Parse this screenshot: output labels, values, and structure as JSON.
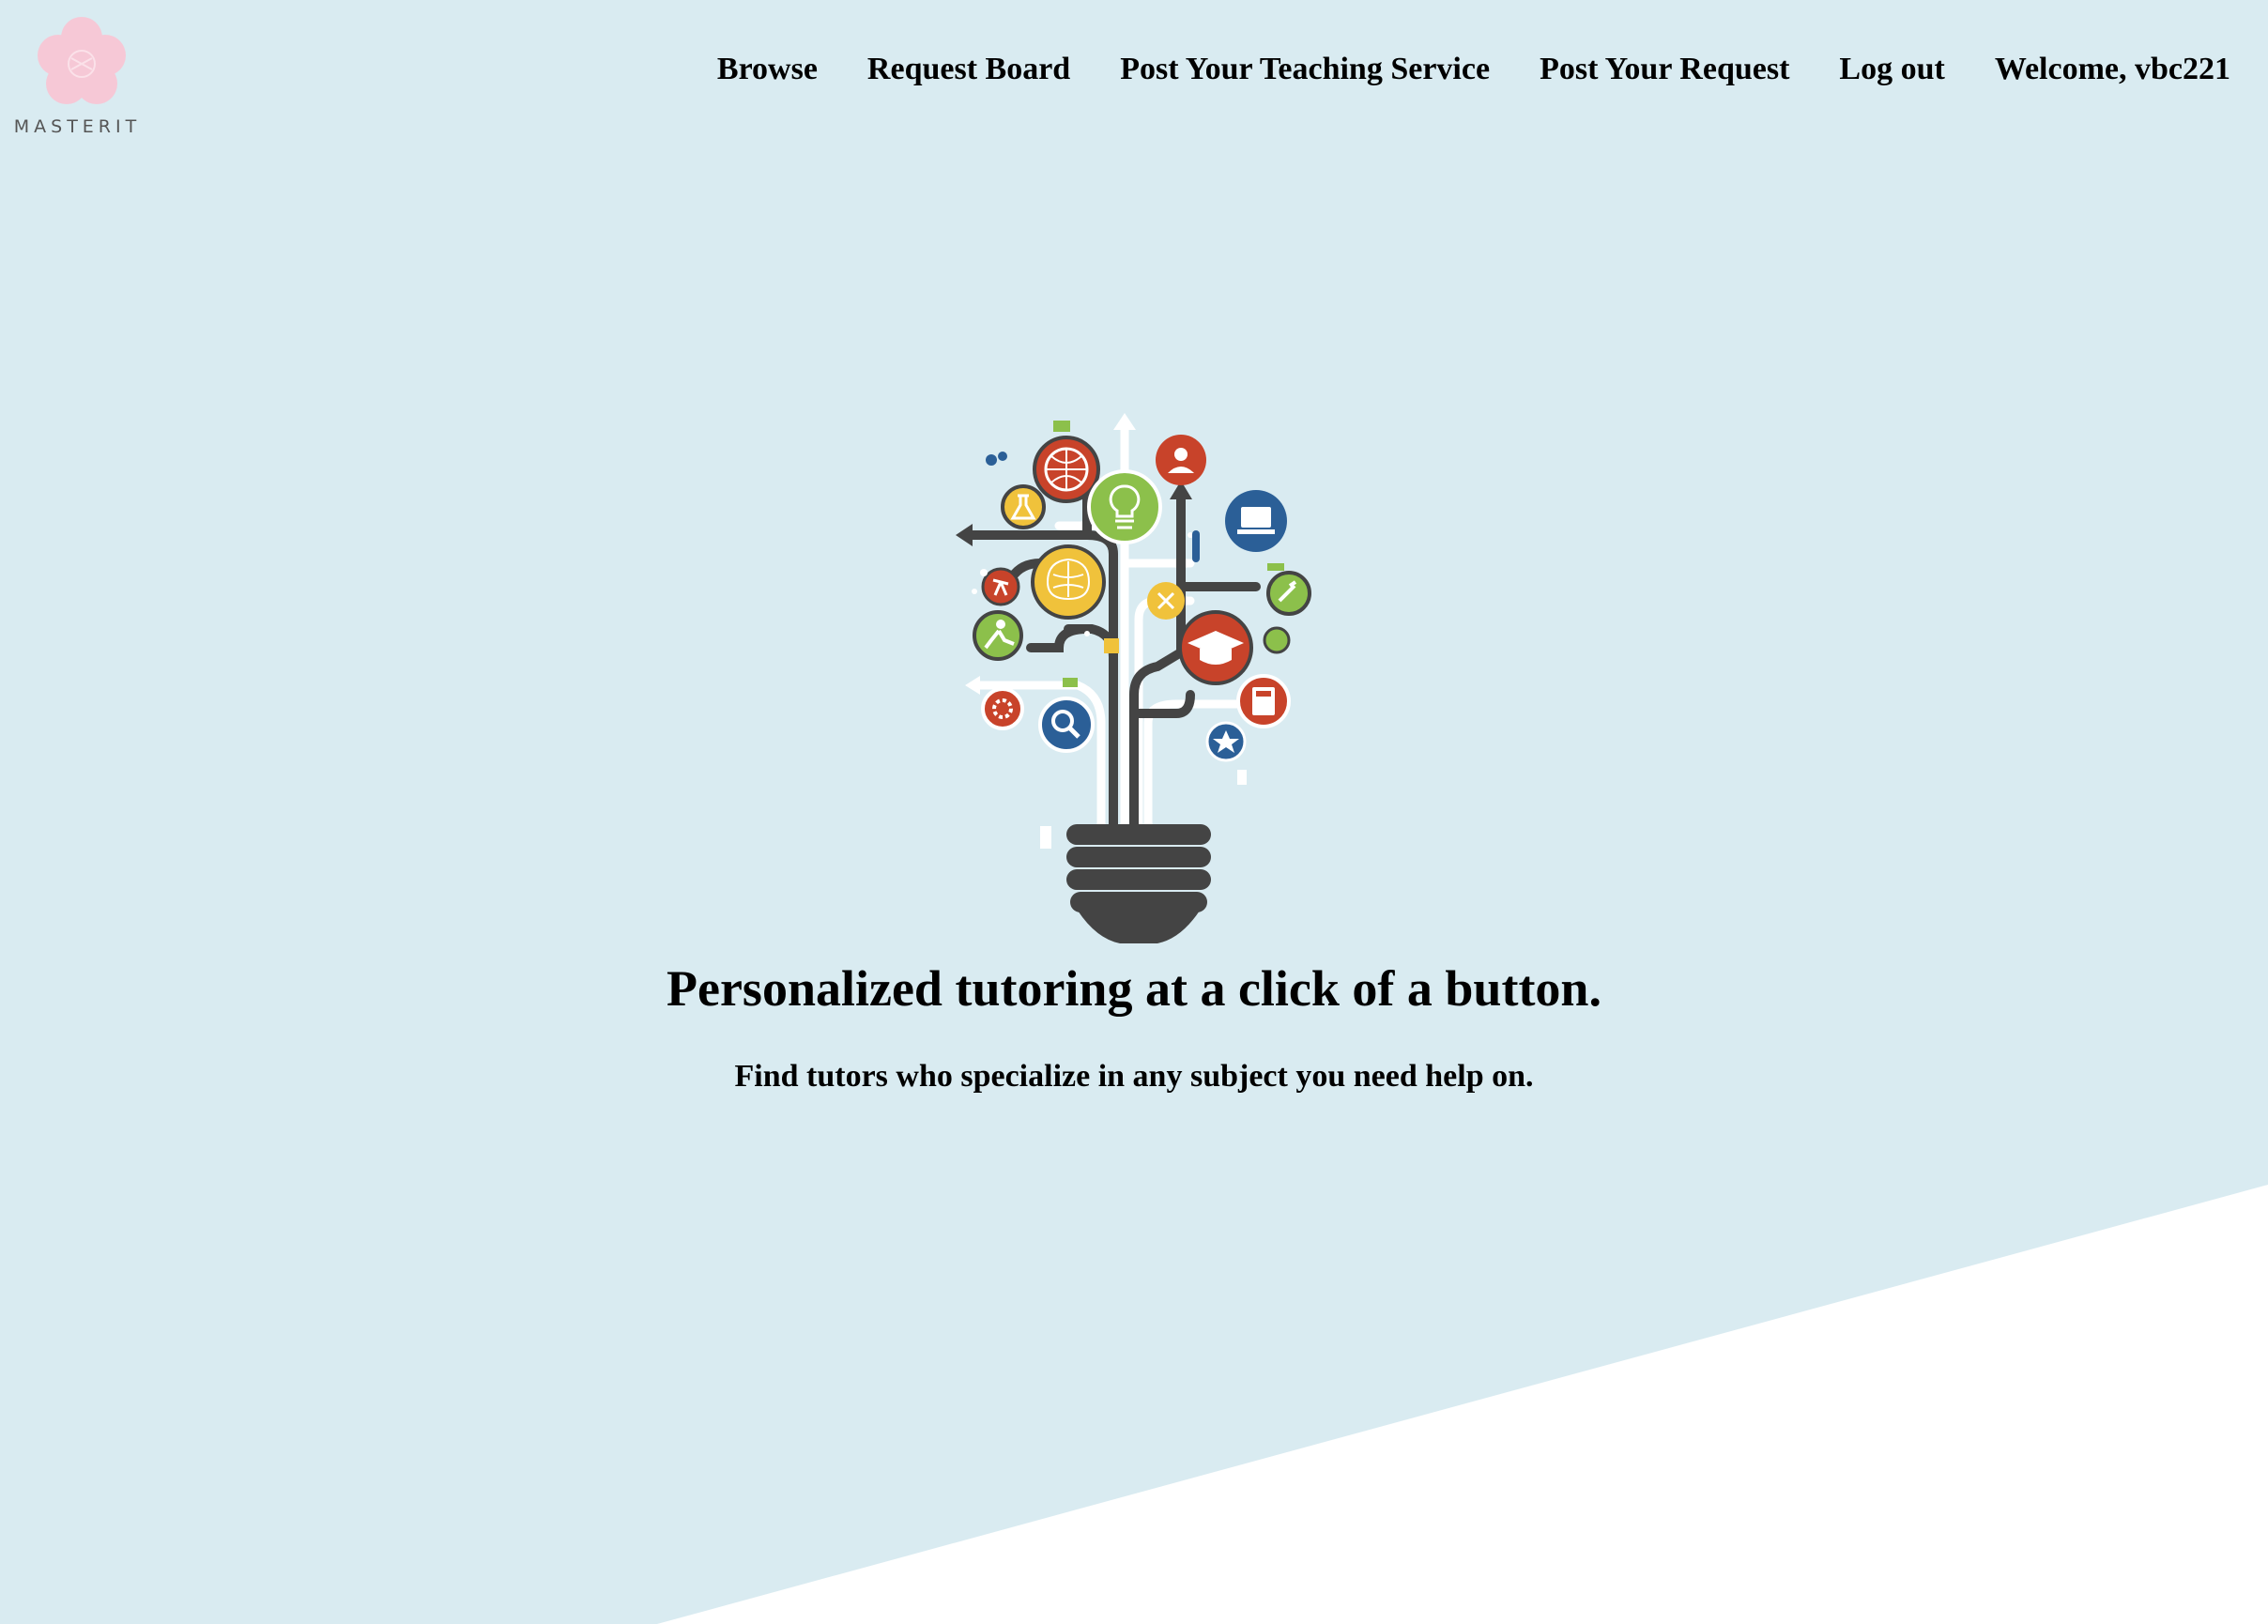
{
  "brand": {
    "name": "MASTERIT",
    "logo_icon": "flower-logo-icon",
    "logo_color": "#f6c8d6"
  },
  "nav": {
    "browse": "Browse",
    "request_board": "Request Board",
    "post_teaching": "Post Your Teaching Service",
    "post_request": "Post Your Request",
    "logout": "Log out",
    "welcome": "Welcome, vbc221"
  },
  "hero": {
    "illustration_icon": "lightbulb-education-icon",
    "headline": "Personalized tutoring at a click of a button.",
    "subheadline": "Find tutors who specialize in any subject you need help on."
  },
  "colors": {
    "background": "#d9ebf1",
    "dark_gray": "#444444",
    "red": "#c8432a",
    "green": "#8cc04b",
    "yellow": "#f0c23b",
    "blue": "#2b5f97"
  }
}
